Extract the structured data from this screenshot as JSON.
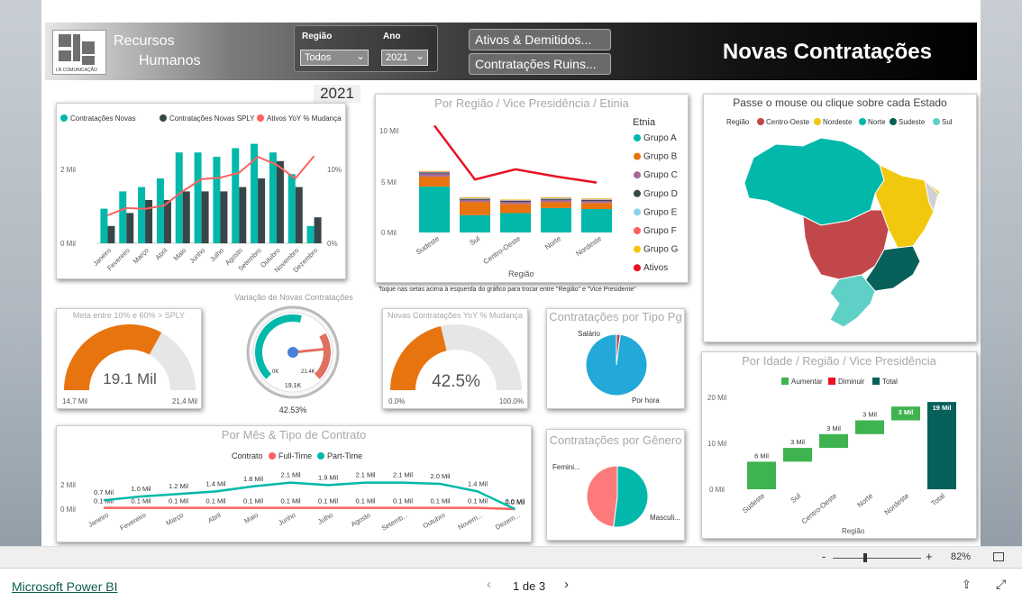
{
  "header": {
    "logo_caption": "LN COMUNICAÇÃO",
    "title_line1": "Recursos",
    "title_line2": "Humanos",
    "slicer_regiao_label": "Região",
    "slicer_regiao_value": "Todos",
    "slicer_ano_label": "Ano",
    "slicer_ano_value": "2021",
    "btn_ativos": "Ativos & Demitidos...",
    "btn_ruins": "Contratações Ruins...",
    "page_title": "Novas Contratações"
  },
  "year_badge": "2021",
  "combo_chart": {
    "legend": [
      "Contratações Novas",
      "Contratações Novas SPLY",
      "Ativos YoY % Mudança"
    ],
    "y_left_ticks": [
      "2 Mil",
      "0 Mil"
    ],
    "y_right_ticks": [
      "10%",
      "0%"
    ],
    "months": [
      "Janeiro",
      "Fevereiro",
      "Março",
      "Abril",
      "Maio",
      "Junho",
      "Julho",
      "Agosto",
      "Setembro",
      "Outubro",
      "Novembro",
      "Dezembro"
    ]
  },
  "region_chart": {
    "title": "Por Região / Vice Presidência / Etinia",
    "y_ticks": [
      "10 Mil",
      "5 Mil",
      "0 Mil"
    ],
    "categories": [
      "Sudeste",
      "Sul",
      "Centro-Oeste",
      "Norte",
      "Nordeste"
    ],
    "xlabel": "Região",
    "legend_title": "Etnia",
    "legend": [
      "Grupo A",
      "Grupo B",
      "Grupo C",
      "Grupo D",
      "Grupo E",
      "Grupo F",
      "Grupo G",
      "Ativos"
    ],
    "note": "Toque nas setas acima à esquerda do gráfico para trocar entre \"Região\" e \"Vice Presidente\""
  },
  "map": {
    "title": "Passe o mouse ou clique sobre cada Estado",
    "legend_title": "Região",
    "legend": [
      "Centro-Oeste",
      "Nordeste",
      "Norte",
      "Sudeste",
      "Sul"
    ]
  },
  "gauge_meta": {
    "title": "Meta entre 10% e 60% > SPLY",
    "value": "19.1 Mil",
    "min": "14,7 Mil",
    "max": "21,4 Mil"
  },
  "gauge_dial": {
    "title": "Variação de Novas Contratações",
    "center_value": "19.1K",
    "min": "0K",
    "max": "21.4K",
    "percent": "42.53%"
  },
  "gauge_yoy": {
    "title": "Novas Contratações YoY % Mudança",
    "value": "42.5%",
    "min": "0.0%",
    "max": "100.0%"
  },
  "pie_pg": {
    "title": "Contratações por Tipo Pg",
    "labels": [
      "Salário",
      "Por hora"
    ]
  },
  "pie_gen": {
    "title": "Contratações por Gênero",
    "labels": [
      "Femini...",
      "Masculi..."
    ]
  },
  "waterfall": {
    "title": "Por Idade / Região / Vice Presidência",
    "legend": [
      "Aumentar",
      "Diminuir",
      "Total"
    ],
    "y_ticks": [
      "20 Mil",
      "10 Mil",
      "0 Mil"
    ],
    "categories": [
      "Sudeste",
      "Sul",
      "Centro-Oeste",
      "Norte",
      "Nordeste",
      "Total"
    ],
    "labels": [
      "6 Mil",
      "3 Mil",
      "3 Mil",
      "3 Mil",
      "3 Mil",
      "19 Mil"
    ],
    "xlabel": "Região"
  },
  "line_chart": {
    "title": "Por Mês & Tipo de Contrato",
    "legend_title": "Contrato",
    "legend": [
      "Full-Time",
      "Part-Time"
    ],
    "y_ticks": [
      "2 Mil",
      "0 Mil"
    ],
    "months": [
      "Janeiro",
      "Fevereiro",
      "Março",
      "Abril",
      "Maio",
      "Junho",
      "Julho",
      "Agosto",
      "Setemb...",
      "Outubro",
      "Novem...",
      "Dezem..."
    ],
    "part_labels": [
      "0.7 Mil",
      "1.0 Mil",
      "1.2 Mil",
      "1.4 Mil",
      "1.8 Mil",
      "2.1 Mil",
      "1.9 Mil",
      "2.1 Mil",
      "2.1 Mil",
      "2.0 Mil",
      "1.4 Mil",
      "0.0 Mil"
    ],
    "full_labels": [
      "0.1 Mil",
      "0.1 Mil",
      "0.1 Mil",
      "0.1 Mil",
      "0.1 Mil",
      "0.1 Mil",
      "0.1 Mil",
      "0.1 Mil",
      "0.1 Mil",
      "0.1 Mil",
      "0.1 Mil",
      "0.0 Mil"
    ]
  },
  "status": {
    "zoom_minus": "-",
    "zoom_plus": "+",
    "zoom": "82%"
  },
  "footer": {
    "brand": "Microsoft Power BI",
    "page_indicator": "1 de 3"
  },
  "colors": {
    "teal": "#01b8aa",
    "dark": "#374649",
    "red": "#fd625e",
    "orange": "#e8740f",
    "green": "#3fb34f",
    "darkgreen": "#08605a"
  },
  "chart_data": [
    {
      "type": "bar",
      "categories": [
        "Janeiro",
        "Fevereiro",
        "Março",
        "Abril",
        "Maio",
        "Junho",
        "Julho",
        "Agosto",
        "Setembro",
        "Outubro",
        "Novembro",
        "Dezembro"
      ],
      "series": [
        {
          "name": "Contratações Novas",
          "values": [
            0.8,
            1.2,
            1.3,
            1.5,
            2.1,
            2.1,
            2.0,
            2.2,
            2.3,
            2.1,
            1.6,
            0.4
          ]
        },
        {
          "name": "Contratações Novas SPLY",
          "values": [
            0.4,
            0.7,
            1.0,
            1.0,
            1.2,
            1.2,
            1.2,
            1.3,
            1.5,
            1.9,
            1.3,
            0.6
          ]
        },
        {
          "name": "Ativos YoY % Mudança",
          "values": [
            3.5,
            4.4,
            4.3,
            4.7,
            6.5,
            8.0,
            8.2,
            8.8,
            10.8,
            9.8,
            8.1,
            10.9
          ]
        }
      ],
      "ylim": [
        0,
        2.5
      ]
    },
    {
      "type": "bar",
      "categories": [
        "Sudeste",
        "Sul",
        "Centro-Oeste",
        "Norte",
        "Nordeste"
      ],
      "series": [
        {
          "name": "Grupo A",
          "values": [
            4.5,
            1.7,
            1.9,
            2.4,
            2.3
          ]
        },
        {
          "name": "Grupo B",
          "values": [
            1.0,
            1.3,
            0.9,
            0.6,
            0.6
          ]
        },
        {
          "name": "Grupo C",
          "values": [
            0.3,
            0.2,
            0.2,
            0.2,
            0.2
          ]
        },
        {
          "name": "Grupo D",
          "values": [
            0.1,
            0.1,
            0.1,
            0.1,
            0.1
          ]
        },
        {
          "name": "Grupo E",
          "values": [
            0.05,
            0.05,
            0.05,
            0.05,
            0.05
          ]
        },
        {
          "name": "Grupo F",
          "values": [
            0.05,
            0.05,
            0.05,
            0.05,
            0.05
          ]
        },
        {
          "name": "Grupo G",
          "values": [
            0.05,
            0.05,
            0.05,
            0.05,
            0.05
          ]
        },
        {
          "name": "Ativos",
          "values": [
            10.5,
            5.2,
            6.2,
            5.5,
            4.9
          ]
        }
      ],
      "ylim": [
        0,
        11
      ]
    },
    {
      "type": "pie",
      "categories": [
        "Salário",
        "Por hora"
      ],
      "values": [
        2,
        98
      ]
    },
    {
      "type": "pie",
      "categories": [
        "Femini...",
        "Masculi..."
      ],
      "values": [
        48,
        52
      ]
    },
    {
      "type": "bar",
      "categories": [
        "Sudeste",
        "Sul",
        "Centro-Oeste",
        "Norte",
        "Nordeste",
        "Total"
      ],
      "values": [
        6,
        3,
        3,
        3,
        3,
        19
      ],
      "ylim": [
        0,
        22
      ]
    },
    {
      "type": "line",
      "x": [
        "Janeiro",
        "Fevereiro",
        "Março",
        "Abril",
        "Maio",
        "Junho",
        "Julho",
        "Agosto",
        "Setemb...",
        "Outubro",
        "Novem...",
        "Dezem..."
      ],
      "series": [
        {
          "name": "Full-Time",
          "values": [
            0.1,
            0.1,
            0.1,
            0.1,
            0.1,
            0.1,
            0.1,
            0.1,
            0.1,
            0.1,
            0.1,
            0.0
          ]
        },
        {
          "name": "Part-Time",
          "values": [
            0.7,
            1.0,
            1.2,
            1.4,
            1.8,
            2.1,
            1.9,
            2.1,
            2.1,
            2.0,
            1.4,
            0.0
          ]
        }
      ],
      "ylim": [
        0,
        2.5
      ]
    }
  ]
}
